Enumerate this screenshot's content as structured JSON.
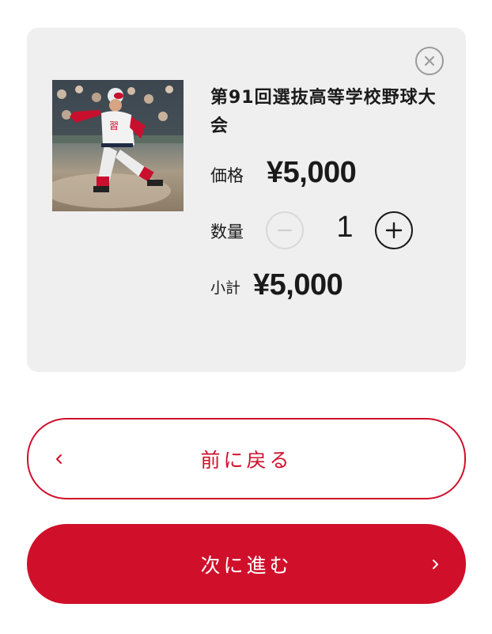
{
  "cart_item": {
    "image_alt": "第91回選抜高等学校野球大会",
    "title": "第91回選抜高等学校野球大会",
    "price_label": "価格",
    "price_value": "¥5,000",
    "quantity_label": "数量",
    "quantity_value": "1",
    "subtotal_label": "小計",
    "subtotal_value": "¥5,000"
  },
  "actions": {
    "back_label": "前に戻る",
    "next_label": "次に進む"
  },
  "colors": {
    "accent": "#d0102b",
    "card_bg": "#efefef",
    "text": "#1a1a1a"
  },
  "icons": {
    "close": "close-icon",
    "minus": "minus-icon",
    "plus": "plus-icon",
    "back": "chevron-left-icon",
    "next": "chevron-right-icon"
  }
}
